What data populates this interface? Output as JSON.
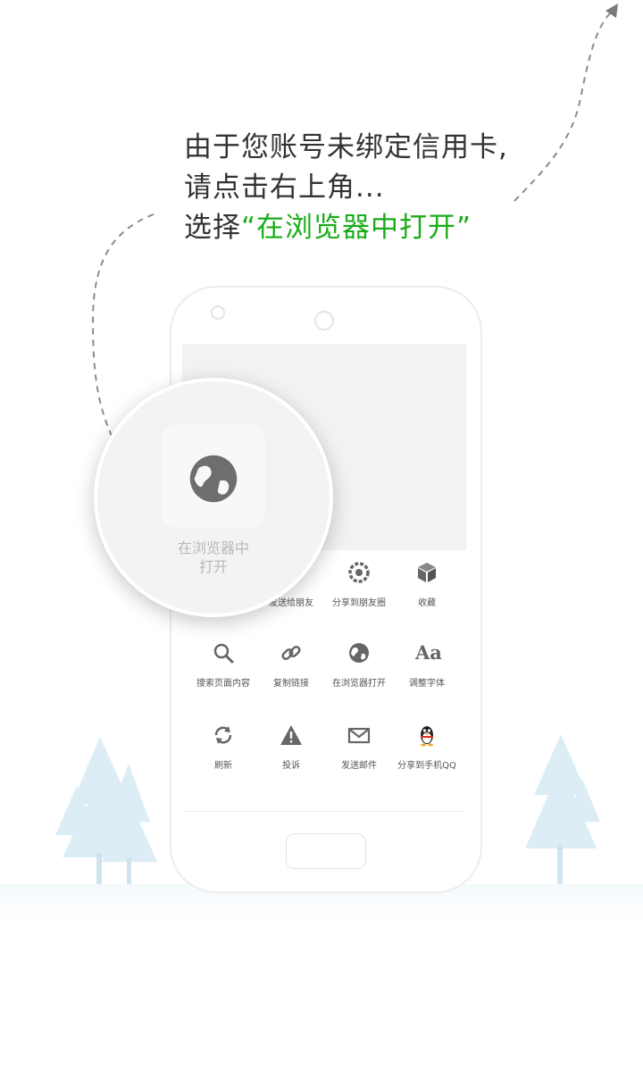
{
  "instruction": {
    "line1": "由于您账号未绑定信用卡,",
    "line2": "请点击右上角...",
    "line3_prefix": "选择",
    "line3_highlight": "“在浏览器中打开”",
    "highlight_color": "#1aad19"
  },
  "magnifier": {
    "icon": "globe-icon",
    "label_line1": "在浏览器中",
    "label_line2": "打开"
  },
  "share_menu": {
    "row1": [
      {
        "label": "发送给朋友",
        "icon": "send-icon"
      },
      {
        "label": "分享到朋友圈",
        "icon": "moments-icon"
      },
      {
        "label": "收藏",
        "icon": "cube-icon"
      }
    ],
    "row2": [
      {
        "label": "搜索页面内容",
        "icon": "search-icon"
      },
      {
        "label": "复制链接",
        "icon": "link-icon"
      },
      {
        "label": "在浏览器打开",
        "icon": "globe-icon"
      },
      {
        "label": "调整字体",
        "icon": "font-icon",
        "glyph": "Aa"
      }
    ],
    "row3": [
      {
        "label": "刷新",
        "icon": "refresh-icon"
      },
      {
        "label": "投诉",
        "icon": "warning-icon"
      },
      {
        "label": "发送邮件",
        "icon": "mail-icon"
      },
      {
        "label": "分享到手机QQ",
        "icon": "qq-penguin-icon"
      }
    ]
  },
  "colors": {
    "text": "#333333",
    "accent": "#1aad19",
    "icon_gray": "#666666",
    "tree": "#d9ecf5"
  }
}
